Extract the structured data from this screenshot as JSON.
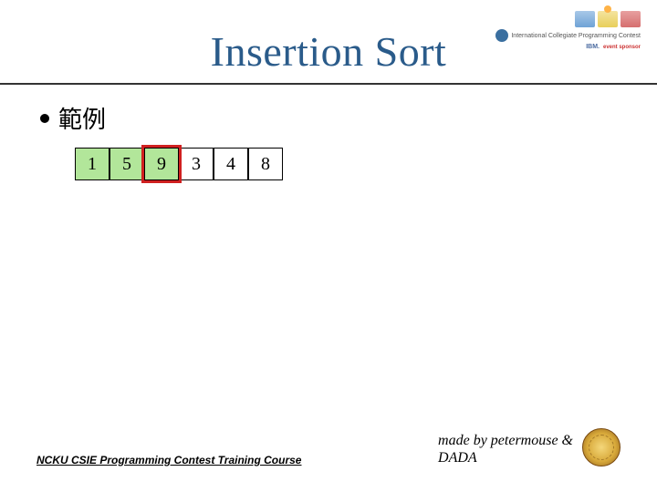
{
  "title": "Insertion Sort",
  "bullet_label": "範例",
  "array": {
    "cells": [
      {
        "value": "1",
        "sorted": true
      },
      {
        "value": "5",
        "sorted": true
      },
      {
        "value": "9",
        "sorted": true
      },
      {
        "value": "3",
        "sorted": false
      },
      {
        "value": "4",
        "sorted": false
      },
      {
        "value": "8",
        "sorted": false
      }
    ],
    "highlight_index": 2
  },
  "logos": {
    "acm_text": "International Collegiate Programming Contest",
    "ibm_text": "IBM.",
    "ibm_sponsor": "event sponsor"
  },
  "footer": {
    "course": "NCKU CSIE Programming Contest Training Course",
    "credit_line1": "made by petermouse &",
    "credit_line2": "DADA"
  }
}
